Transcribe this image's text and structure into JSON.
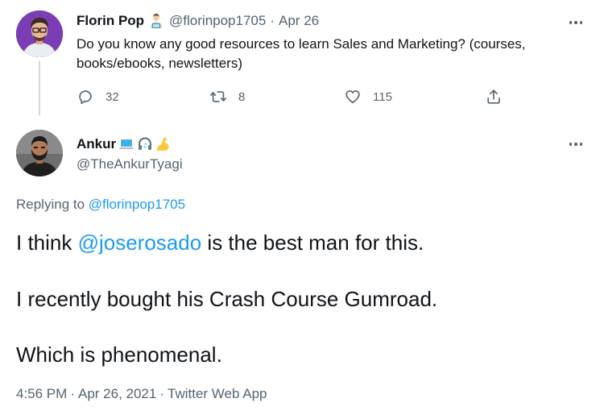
{
  "parent_tweet": {
    "author_name": "Florin Pop",
    "author_badge_icon": "man-technologist-emoji",
    "handle": "@florinpop1705",
    "separator": "·",
    "date": "Apr 26",
    "text": "Do you know any good resources to learn Sales and Marketing? (courses, books/ebooks, newsletters)",
    "replies": "32",
    "retweets": "8",
    "likes": "115",
    "more_icon": "more-horizontal-icon"
  },
  "reply_tweet": {
    "author_name": "Ankur",
    "author_emojis": [
      "laptop-emoji",
      "headphones-emoji",
      "flexed-biceps-emoji"
    ],
    "handle": "@TheAnkurTyagi",
    "replying_prefix": "Replying to",
    "replying_to": "@florinpop1705",
    "line1_before": "I think ",
    "line1_mention": "@joserosado",
    "line1_after": " is the best man for this.",
    "line2": "I recently bought his Crash Course Gumroad.",
    "line3": "Which is phenomenal.",
    "time": "4:56 PM",
    "separator": "·",
    "date": "Apr 26, 2021",
    "source": "Twitter Web App",
    "more_icon": "more-horizontal-icon"
  },
  "colors": {
    "link": "#1d9bf0",
    "text": "#0f1419",
    "muted": "#536471",
    "thread_line": "#cfd9de"
  }
}
